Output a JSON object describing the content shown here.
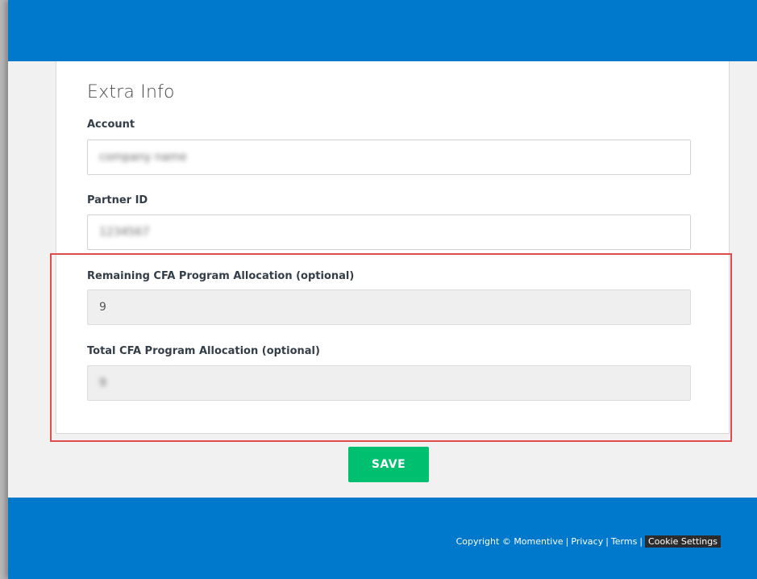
{
  "form": {
    "section_title": "Extra Info",
    "fields": [
      {
        "label": "Account",
        "value": "company name"
      },
      {
        "label": "Partner ID",
        "value": "1234567"
      },
      {
        "label": "Remaining CFA Program Allocation (optional)",
        "value": "9"
      },
      {
        "label": "Total CFA Program Allocation (optional)",
        "value": "9"
      }
    ]
  },
  "actions": {
    "save_label": "SAVE"
  },
  "footer": {
    "copyright": "Copyright © Momentive",
    "privacy": "Privacy",
    "terms": "Terms",
    "cookie_settings": "Cookie Settings",
    "separator": "|"
  },
  "colors": {
    "header": "#0078cc",
    "save_button": "#00bf6f",
    "highlight": "#e04b4b"
  }
}
